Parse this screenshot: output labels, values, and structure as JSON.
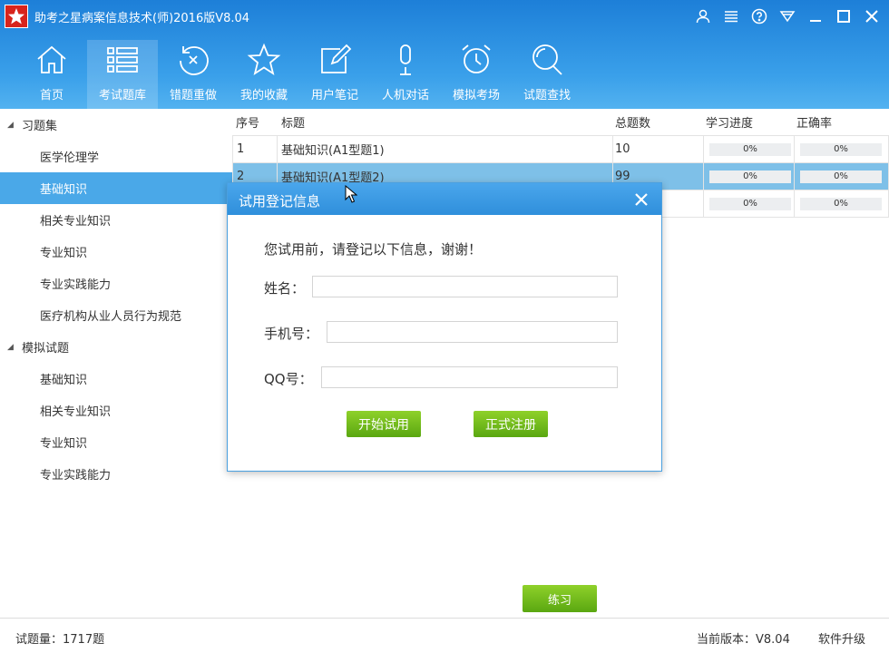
{
  "window": {
    "title": "助考之星病案信息技术(师)2016版V8.04"
  },
  "toolbar": {
    "items": [
      {
        "label": "首页",
        "icon": "home-icon"
      },
      {
        "label": "考试题库",
        "icon": "list-icon"
      },
      {
        "label": "错题重做",
        "icon": "redo-icon"
      },
      {
        "label": "我的收藏",
        "icon": "star-icon"
      },
      {
        "label": "用户笔记",
        "icon": "note-icon"
      },
      {
        "label": "人机对话",
        "icon": "microphone-icon"
      },
      {
        "label": "模拟考场",
        "icon": "alarm-clock-icon"
      },
      {
        "label": "试题查找",
        "icon": "search-icon"
      }
    ],
    "active_index": 1
  },
  "sidebar": {
    "groups": [
      {
        "label": "习题集",
        "items": [
          "医学伦理学",
          "基础知识",
          "相关专业知识",
          "专业知识",
          "专业实践能力",
          "医疗机构从业人员行为规范"
        ]
      },
      {
        "label": "模拟试题",
        "items": [
          "基础知识",
          "相关专业知识",
          "专业知识",
          "专业实践能力"
        ]
      }
    ],
    "selected": "基础知识"
  },
  "table": {
    "headers": [
      "序号",
      "标题",
      "总题数",
      "学习进度",
      "正确率"
    ],
    "rows": [
      {
        "idx": "1",
        "title": "基础知识(A1型题1)",
        "total": "10",
        "progress": "0%",
        "accuracy": "0%"
      },
      {
        "idx": "2",
        "title": "基础知识(A1型题2)",
        "total": "99",
        "progress": "0%",
        "accuracy": "0%"
      },
      {
        "idx": "",
        "title": "",
        "total": "",
        "progress": "0%",
        "accuracy": "0%"
      }
    ]
  },
  "dialog": {
    "title": "试用登记信息",
    "message": "您试用前，请登记以下信息，谢谢！",
    "name_label": "姓名：",
    "phone_label": "手机号：",
    "qq_label": "QQ号：",
    "name_value": "",
    "phone_value": "",
    "qq_value": "",
    "trial_button": "开始试用",
    "register_button": "正式注册"
  },
  "practice_button": "练习",
  "status": {
    "count": "试题量：1717题",
    "version": "当前版本：V8.04",
    "upgrade": "软件升级"
  },
  "colors": {
    "header": "#2a8de0",
    "selection": "#4aa8e8",
    "green_button": "#6cb81a"
  }
}
